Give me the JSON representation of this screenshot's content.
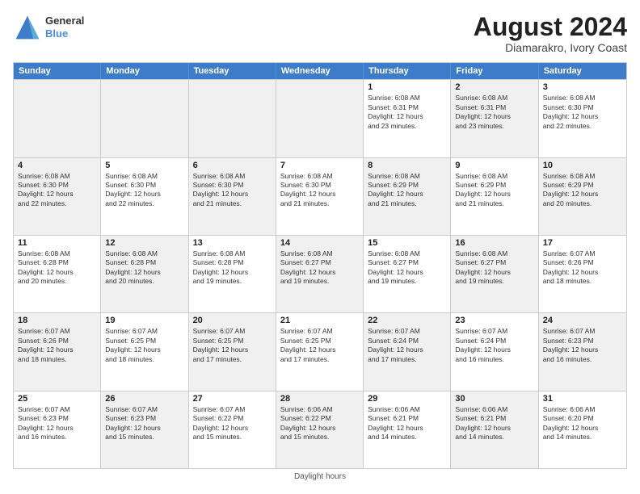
{
  "header": {
    "logo_line1": "General",
    "logo_line2": "Blue",
    "main_title": "August 2024",
    "subtitle": "Diamarakro, Ivory Coast"
  },
  "days_of_week": [
    "Sunday",
    "Monday",
    "Tuesday",
    "Wednesday",
    "Thursday",
    "Friday",
    "Saturday"
  ],
  "weeks": [
    [
      {
        "day": "",
        "text": "",
        "shaded": true
      },
      {
        "day": "",
        "text": "",
        "shaded": true
      },
      {
        "day": "",
        "text": "",
        "shaded": true
      },
      {
        "day": "",
        "text": "",
        "shaded": true
      },
      {
        "day": "1",
        "text": "Sunrise: 6:08 AM\nSunset: 6:31 PM\nDaylight: 12 hours\nand 23 minutes.",
        "shaded": false
      },
      {
        "day": "2",
        "text": "Sunrise: 6:08 AM\nSunset: 6:31 PM\nDaylight: 12 hours\nand 23 minutes.",
        "shaded": true
      },
      {
        "day": "3",
        "text": "Sunrise: 6:08 AM\nSunset: 6:30 PM\nDaylight: 12 hours\nand 22 minutes.",
        "shaded": false
      }
    ],
    [
      {
        "day": "4",
        "text": "Sunrise: 6:08 AM\nSunset: 6:30 PM\nDaylight: 12 hours\nand 22 minutes.",
        "shaded": true
      },
      {
        "day": "5",
        "text": "Sunrise: 6:08 AM\nSunset: 6:30 PM\nDaylight: 12 hours\nand 22 minutes.",
        "shaded": false
      },
      {
        "day": "6",
        "text": "Sunrise: 6:08 AM\nSunset: 6:30 PM\nDaylight: 12 hours\nand 21 minutes.",
        "shaded": true
      },
      {
        "day": "7",
        "text": "Sunrise: 6:08 AM\nSunset: 6:30 PM\nDaylight: 12 hours\nand 21 minutes.",
        "shaded": false
      },
      {
        "day": "8",
        "text": "Sunrise: 6:08 AM\nSunset: 6:29 PM\nDaylight: 12 hours\nand 21 minutes.",
        "shaded": true
      },
      {
        "day": "9",
        "text": "Sunrise: 6:08 AM\nSunset: 6:29 PM\nDaylight: 12 hours\nand 21 minutes.",
        "shaded": false
      },
      {
        "day": "10",
        "text": "Sunrise: 6:08 AM\nSunset: 6:29 PM\nDaylight: 12 hours\nand 20 minutes.",
        "shaded": true
      }
    ],
    [
      {
        "day": "11",
        "text": "Sunrise: 6:08 AM\nSunset: 6:28 PM\nDaylight: 12 hours\nand 20 minutes.",
        "shaded": false
      },
      {
        "day": "12",
        "text": "Sunrise: 6:08 AM\nSunset: 6:28 PM\nDaylight: 12 hours\nand 20 minutes.",
        "shaded": true
      },
      {
        "day": "13",
        "text": "Sunrise: 6:08 AM\nSunset: 6:28 PM\nDaylight: 12 hours\nand 19 minutes.",
        "shaded": false
      },
      {
        "day": "14",
        "text": "Sunrise: 6:08 AM\nSunset: 6:27 PM\nDaylight: 12 hours\nand 19 minutes.",
        "shaded": true
      },
      {
        "day": "15",
        "text": "Sunrise: 6:08 AM\nSunset: 6:27 PM\nDaylight: 12 hours\nand 19 minutes.",
        "shaded": false
      },
      {
        "day": "16",
        "text": "Sunrise: 6:08 AM\nSunset: 6:27 PM\nDaylight: 12 hours\nand 19 minutes.",
        "shaded": true
      },
      {
        "day": "17",
        "text": "Sunrise: 6:07 AM\nSunset: 6:26 PM\nDaylight: 12 hours\nand 18 minutes.",
        "shaded": false
      }
    ],
    [
      {
        "day": "18",
        "text": "Sunrise: 6:07 AM\nSunset: 6:26 PM\nDaylight: 12 hours\nand 18 minutes.",
        "shaded": true
      },
      {
        "day": "19",
        "text": "Sunrise: 6:07 AM\nSunset: 6:25 PM\nDaylight: 12 hours\nand 18 minutes.",
        "shaded": false
      },
      {
        "day": "20",
        "text": "Sunrise: 6:07 AM\nSunset: 6:25 PM\nDaylight: 12 hours\nand 17 minutes.",
        "shaded": true
      },
      {
        "day": "21",
        "text": "Sunrise: 6:07 AM\nSunset: 6:25 PM\nDaylight: 12 hours\nand 17 minutes.",
        "shaded": false
      },
      {
        "day": "22",
        "text": "Sunrise: 6:07 AM\nSunset: 6:24 PM\nDaylight: 12 hours\nand 17 minutes.",
        "shaded": true
      },
      {
        "day": "23",
        "text": "Sunrise: 6:07 AM\nSunset: 6:24 PM\nDaylight: 12 hours\nand 16 minutes.",
        "shaded": false
      },
      {
        "day": "24",
        "text": "Sunrise: 6:07 AM\nSunset: 6:23 PM\nDaylight: 12 hours\nand 16 minutes.",
        "shaded": true
      }
    ],
    [
      {
        "day": "25",
        "text": "Sunrise: 6:07 AM\nSunset: 6:23 PM\nDaylight: 12 hours\nand 16 minutes.",
        "shaded": false
      },
      {
        "day": "26",
        "text": "Sunrise: 6:07 AM\nSunset: 6:23 PM\nDaylight: 12 hours\nand 15 minutes.",
        "shaded": true
      },
      {
        "day": "27",
        "text": "Sunrise: 6:07 AM\nSunset: 6:22 PM\nDaylight: 12 hours\nand 15 minutes.",
        "shaded": false
      },
      {
        "day": "28",
        "text": "Sunrise: 6:06 AM\nSunset: 6:22 PM\nDaylight: 12 hours\nand 15 minutes.",
        "shaded": true
      },
      {
        "day": "29",
        "text": "Sunrise: 6:06 AM\nSunset: 6:21 PM\nDaylight: 12 hours\nand 14 minutes.",
        "shaded": false
      },
      {
        "day": "30",
        "text": "Sunrise: 6:06 AM\nSunset: 6:21 PM\nDaylight: 12 hours\nand 14 minutes.",
        "shaded": true
      },
      {
        "day": "31",
        "text": "Sunrise: 6:06 AM\nSunset: 6:20 PM\nDaylight: 12 hours\nand 14 minutes.",
        "shaded": false
      }
    ]
  ],
  "footer": "Daylight hours"
}
